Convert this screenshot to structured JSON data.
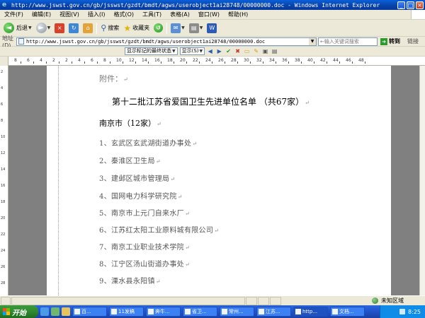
{
  "window": {
    "title": "http://www.jswst.gov.cn/gb/jsswst/gzdt/bmdt/agws/userobject1ai28748/00000000.doc - Windows Internet Explorer"
  },
  "menu": [
    "文件(F)",
    "编辑(E)",
    "视图(V)",
    "插入(I)",
    "格式(O)",
    "工具(T)",
    "表格(A)",
    "窗口(W)",
    "帮助(H)"
  ],
  "toolbar": {
    "back_label": "后退",
    "search_label": "搜索",
    "favorites_label": "收藏夹"
  },
  "address": {
    "label": "地址(D)",
    "url": "http://www.jswst.gov.cn/gb/jsswst/gzdt/bmdt/agws/userobject1ai28748/00000000.doc",
    "search_placeholder": "←输入关键词搜索",
    "go_label": "转到",
    "links_label": "链接"
  },
  "word_toolbar": {
    "markup_mode": "显示标记的最终状态",
    "show_label": "显示(S)"
  },
  "ruler": {
    "top_numbers": [
      "8",
      "6",
      "4",
      "2",
      "2",
      "4",
      "6",
      "8",
      "10",
      "12",
      "14",
      "16",
      "18",
      "20",
      "22",
      "24",
      "26",
      "28",
      "30",
      "32",
      "34",
      "36",
      "38",
      "40",
      "42",
      "44",
      "46",
      "48"
    ],
    "left_numbers": [
      "2",
      "4",
      "6",
      "8",
      "10",
      "12",
      "14",
      "16",
      "18",
      "20",
      "22",
      "24",
      "26",
      "28"
    ]
  },
  "document": {
    "attachment": "附件：",
    "title": "第十二批江苏省爱国卫生先进单位名单 （共67家）",
    "city_heading": "南京市（12家）",
    "entries": [
      "1、玄武区玄武湖街道办事处",
      "2、秦淮区卫生局",
      "3、建邺区城市管理局",
      "4、国网电力科学研究院",
      "5、南京市上元门自来水厂",
      "6、江苏红太阳工业原料城有限公司",
      "7、南京工业职业技术学院",
      "8、江宁区汤山街道办事处",
      "9、溧水县永阳镇"
    ],
    "paragraph_mark": "↵"
  },
  "status": {
    "zone": "未知区域"
  },
  "taskbar": {
    "start": "开始",
    "tasks": [
      "百...",
      "11发稿",
      "奔牛...",
      "省卫...",
      "常州...",
      "江苏...",
      "http...",
      "文档..."
    ],
    "clock": "8:25"
  }
}
